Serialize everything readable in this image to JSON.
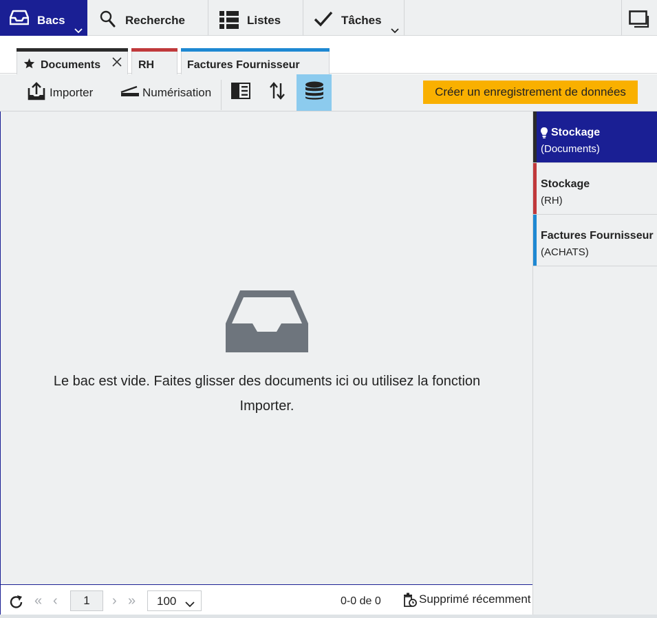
{
  "topnav": {
    "items": [
      {
        "label": "Bacs",
        "icon": "inbox-tray-icon",
        "active": true,
        "has_dropdown": true
      },
      {
        "label": "Recherche",
        "icon": "search-icon"
      },
      {
        "label": "Listes",
        "icon": "list-icon"
      },
      {
        "label": "Tâches",
        "icon": "checkmark-icon",
        "has_dropdown": true
      }
    ],
    "window_icon": "window-icon"
  },
  "tabs": [
    {
      "label": "Documents",
      "icon": "star-icon",
      "closable": true,
      "color": "#2b2b2b",
      "active": true
    },
    {
      "label": "RH",
      "color": "#c0393b"
    },
    {
      "label": "Factures Fournisseur",
      "color": "#1e88d2"
    }
  ],
  "toolbar": {
    "import_label": "Importer",
    "scan_label": "Numérisation",
    "layout_icon": "panel-layout-icon",
    "sort_icon": "sort-arrows-icon",
    "storage_icon": "database-icon",
    "create_label": "Créer un enregistrement de données"
  },
  "main": {
    "empty_icon": "empty-tray-icon",
    "empty_message": "Le bac est vide. Faites glisser des documents ici ou utilisez la fonction Importer."
  },
  "sidebar": {
    "items": [
      {
        "title": "Stockage",
        "subtitle": "(Documents)",
        "color": "#2b2b2b",
        "active": true,
        "icon": "lightbulb-icon"
      },
      {
        "title": "Stockage",
        "subtitle": "(RH)",
        "color": "#c0393b"
      },
      {
        "title": "Factures Fournisseur",
        "subtitle": "(ACHATS)",
        "color": "#1e88d2"
      }
    ]
  },
  "footer": {
    "refresh_icon": "refresh-icon",
    "first_symbol": "«",
    "prev_symbol": "‹",
    "next_symbol": "›",
    "last_symbol": "»",
    "page": "1",
    "page_size": "100",
    "count": "0-0 de 0",
    "deleted_label": "Supprimé récemment"
  },
  "colors": {
    "accent": "#1a1f94",
    "highlight": "#8ccbee",
    "create_button": "#f9b000",
    "panel_bg": "#eef0f1"
  }
}
